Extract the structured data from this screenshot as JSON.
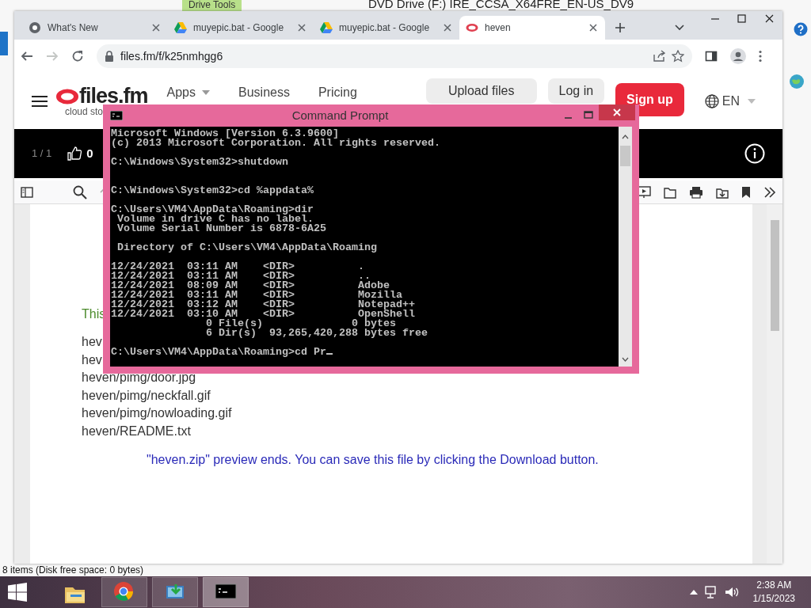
{
  "explorer": {
    "ribbon_tab": "Drive Tools",
    "title": "DVD Drive (F:) IRE_CCSA_X64FRE_EN-US_DV9",
    "status": "8 items (Disk free space: 0 bytes)"
  },
  "browser": {
    "tabs": [
      {
        "kind": "chrome",
        "title": "What's New",
        "selected": false
      },
      {
        "kind": "drive",
        "title": "muyepic.bat - Google",
        "selected": false
      },
      {
        "kind": "drive",
        "title": "muyepic.bat - Google",
        "selected": false
      },
      {
        "kind": "files",
        "title": "heven",
        "selected": true
      }
    ],
    "url": "files.fm/f/k25nmhgg6"
  },
  "site": {
    "logo": "files.fm",
    "tagline": "cloud sto",
    "nav": [
      {
        "label": "Apps",
        "dropdown": true
      },
      {
        "label": "Business",
        "dropdown": false
      },
      {
        "label": "Pricing",
        "dropdown": false
      }
    ],
    "buttons": [
      {
        "kind": "secondary",
        "label": "Upload files"
      },
      {
        "kind": "secondary",
        "label": "Log in"
      },
      {
        "kind": "primary",
        "label": "Sign up"
      }
    ],
    "language": "EN"
  },
  "viewer": {
    "pages": "1 / 1",
    "likes": "0"
  },
  "preview": {
    "intro": "This",
    "files": [
      "hev",
      "hev",
      "heven/pimg/door.jpg",
      "heven/pimg/neckfall.gif",
      "heven/pimg/nowloading.gif",
      "heven/README.txt"
    ],
    "notice": "\"heven.zip\" preview ends. You can save this file by clicking the Download button."
  },
  "console": {
    "title": "Command Prompt",
    "text": "Microsoft Windows [Version 6.3.9600]\n(c) 2013 Microsoft Corporation. All rights reserved.\n\nC:\\Windows\\System32>shutdown\n\n\nC:\\Windows\\System32>cd %appdata%\n\nC:\\Users\\VM4\\AppData\\Roaming>dir\n Volume in drive C has no label.\n Volume Serial Number is 6878-6A25\n\n Directory of C:\\Users\\VM4\\AppData\\Roaming\n\n12/24/2021  03:11 AM    <DIR>          .\n12/24/2021  03:11 AM    <DIR>          ..\n12/24/2021  08:09 AM    <DIR>          Adobe\n12/24/2021  03:11 AM    <DIR>          Mozilla\n12/24/2021  03:12 AM    <DIR>          Notepad++\n12/24/2021  03:10 AM    <DIR>          OpenShell\n               0 File(s)              0 bytes\n               6 Dir(s)  93,265,420,288 bytes free\n\nC:\\Users\\VM4\\AppData\\Roaming>cd Pr",
    "cursor": true
  },
  "taskbar": {
    "apps": [
      {
        "kind": "explorer",
        "running": false,
        "selected": false
      },
      {
        "kind": "chrome",
        "running": true,
        "selected": false
      },
      {
        "kind": "installer",
        "running": true,
        "selected": false
      },
      {
        "kind": "console",
        "running": true,
        "selected": true
      }
    ],
    "time": "2:38 AM",
    "date": "1/15/2023"
  }
}
